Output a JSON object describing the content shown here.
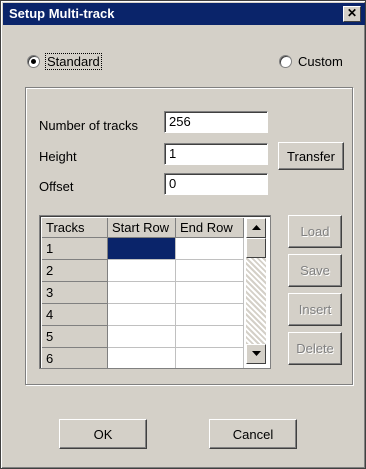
{
  "window": {
    "title": "Setup Multi-track",
    "close_glyph": "✕"
  },
  "mode": {
    "standard_label": "Standard",
    "custom_label": "Custom",
    "selected": "Standard"
  },
  "fields": {
    "number_of_tracks_label": "Number of tracks",
    "number_of_tracks_value": "256",
    "height_label": "Height",
    "height_value": "1",
    "offset_label": "Offset",
    "offset_value": "0"
  },
  "buttons": {
    "transfer": "Transfer",
    "load": "Load",
    "save": "Save",
    "insert": "Insert",
    "delete": "Delete",
    "ok": "OK",
    "cancel": "Cancel"
  },
  "grid": {
    "columns": [
      "Tracks",
      "Start Row",
      "End Row"
    ],
    "rows": [
      "1",
      "2",
      "3",
      "4",
      "5",
      "6"
    ],
    "selected_cell": {
      "row": 1,
      "column": "Start Row"
    }
  },
  "colors": {
    "face": "#d4d0c8",
    "title_bar": "#0a246a",
    "selection": "#0a246a"
  },
  "icons": {
    "close": "close-icon",
    "scroll_up": "arrow-up-icon",
    "scroll_down": "arrow-down-icon"
  }
}
